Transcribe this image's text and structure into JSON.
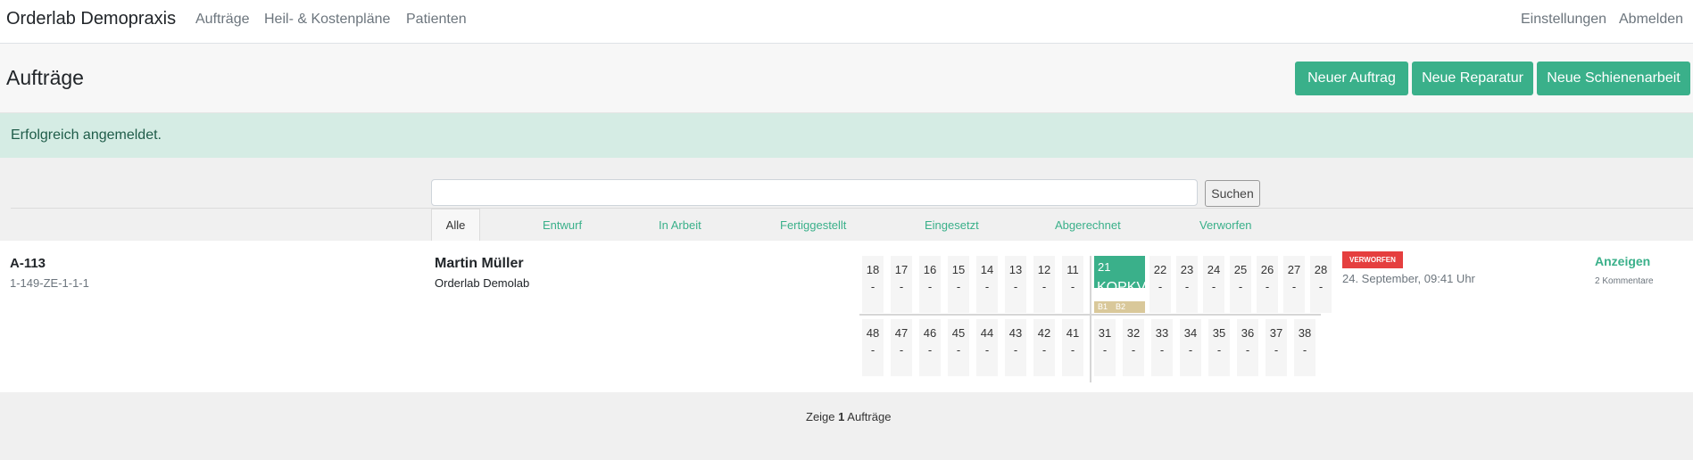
{
  "navbar": {
    "brand": "Orderlab Demopraxis",
    "links": [
      "Aufträge",
      "Heil- & Kostenpläne",
      "Patienten"
    ],
    "right_links": [
      "Einstellungen",
      "Abmelden"
    ]
  },
  "header": {
    "title": "Aufträge",
    "buttons": [
      "Neuer Auftrag",
      "Neue Reparatur",
      "Neue Schienenarbeit"
    ]
  },
  "alert": {
    "text": "Erfolgreich angemeldet."
  },
  "search": {
    "value": "",
    "placeholder": "",
    "button": "Suchen"
  },
  "tabs": {
    "active": "Alle",
    "items": [
      "Entwurf",
      "In Arbeit",
      "Fertiggestellt",
      "Eingesetzt",
      "Abgerechnet",
      "Verworfen"
    ]
  },
  "order": {
    "id": "A-113",
    "code": "1-149-ZE-1-1-1",
    "patient": "Martin Müller",
    "lab": "Orderlab Demolab",
    "teeth": {
      "upper_right": [
        {
          "num": "18",
          "val": "-"
        },
        {
          "num": "17",
          "val": "-"
        },
        {
          "num": "16",
          "val": "-"
        },
        {
          "num": "15",
          "val": "-"
        },
        {
          "num": "14",
          "val": "-"
        },
        {
          "num": "13",
          "val": "-"
        },
        {
          "num": "12",
          "val": "-"
        },
        {
          "num": "11",
          "val": "-"
        }
      ],
      "upper_left_selected": {
        "num": "21",
        "code": "KOPKV",
        "tags": [
          "B1",
          "B2"
        ]
      },
      "upper_left": [
        {
          "num": "22",
          "val": "-"
        },
        {
          "num": "23",
          "val": "-"
        },
        {
          "num": "24",
          "val": "-"
        },
        {
          "num": "25",
          "val": "-"
        },
        {
          "num": "26",
          "val": "-"
        },
        {
          "num": "27",
          "val": "-"
        },
        {
          "num": "28",
          "val": "-"
        }
      ],
      "lower_right": [
        {
          "num": "48",
          "val": "-"
        },
        {
          "num": "47",
          "val": "-"
        },
        {
          "num": "46",
          "val": "-"
        },
        {
          "num": "45",
          "val": "-"
        },
        {
          "num": "44",
          "val": "-"
        },
        {
          "num": "43",
          "val": "-"
        },
        {
          "num": "42",
          "val": "-"
        },
        {
          "num": "41",
          "val": "-"
        }
      ],
      "lower_left": [
        {
          "num": "31",
          "val": "-"
        },
        {
          "num": "32",
          "val": "-"
        },
        {
          "num": "33",
          "val": "-"
        },
        {
          "num": "34",
          "val": "-"
        },
        {
          "num": "35",
          "val": "-"
        },
        {
          "num": "36",
          "val": "-"
        },
        {
          "num": "37",
          "val": "-"
        },
        {
          "num": "38",
          "val": "-"
        }
      ]
    },
    "status": "VERWORFEN",
    "status_color": "#e53f3f",
    "date": "24. September, 09:41 Uhr",
    "show_link": "Anzeigen",
    "comments": "2 Kommentare"
  },
  "footer": {
    "prefix": "Zeige",
    "count": "1",
    "suffix": "Aufträge"
  },
  "colors": {
    "accent": "#3ab08a",
    "alert_bg": "#d5ece4",
    "danger": "#e53f3f",
    "tag_bg": "#d9c89a"
  }
}
